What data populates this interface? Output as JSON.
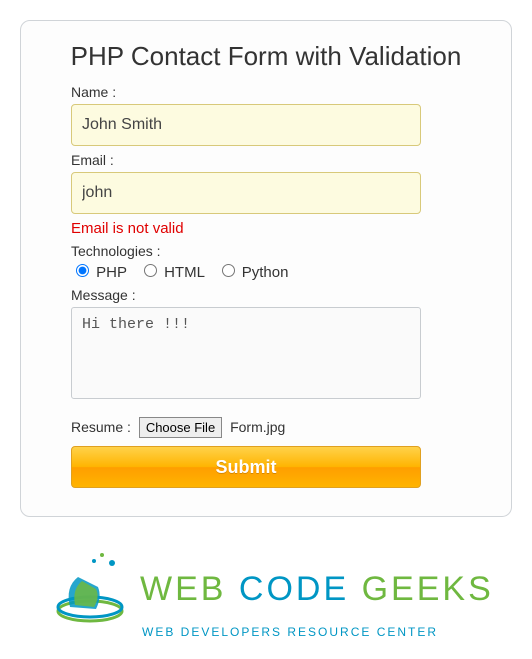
{
  "title": "PHP Contact Form with Validation",
  "fields": {
    "name": {
      "label": "Name :",
      "value": "John Smith"
    },
    "email": {
      "label": "Email :",
      "value": "john",
      "error": "Email is not valid"
    },
    "technologies": {
      "label": "Technologies :",
      "options": [
        "PHP",
        "HTML",
        "Python"
      ],
      "selected": "PHP"
    },
    "message": {
      "label": "Message :",
      "value": "Hi there !!!"
    },
    "resume": {
      "label": "Resume :",
      "button": "Choose File",
      "filename": "Form.jpg"
    }
  },
  "submit_label": "Submit",
  "logo": {
    "word1": "WEB",
    "word2": "CODE",
    "word3": "GEEKS",
    "tagline": "WEB DEVELOPERS RESOURCE CENTER"
  }
}
